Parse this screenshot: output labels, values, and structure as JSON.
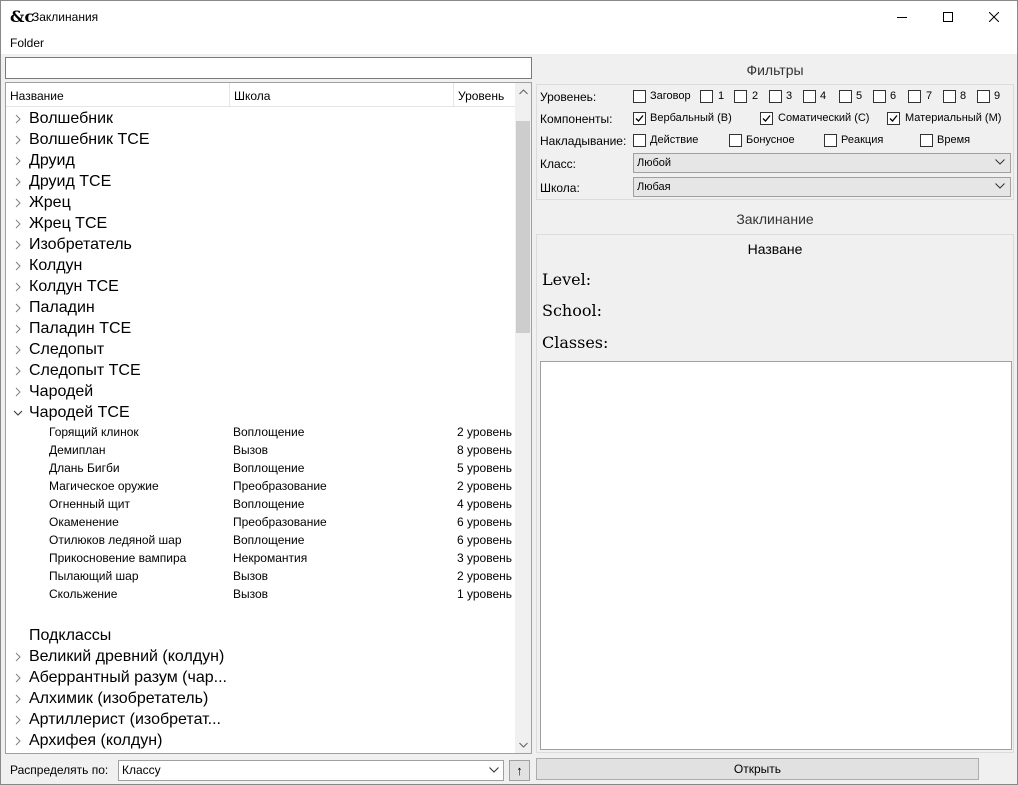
{
  "window": {
    "title": "Заклинания",
    "app_icon_glyph": "&c"
  },
  "menu": {
    "folder": "Folder"
  },
  "search": {
    "value": "",
    "placeholder": ""
  },
  "tree": {
    "columns": [
      "Название",
      "Школа",
      "Уровень"
    ],
    "groups": [
      {
        "label": "Волшебник",
        "expanded": false
      },
      {
        "label": "Волшебник  TCE",
        "expanded": false
      },
      {
        "label": "Друид",
        "expanded": false
      },
      {
        "label": "Друид  TCE",
        "expanded": false
      },
      {
        "label": "Жрец",
        "expanded": false
      },
      {
        "label": "Жрец  TCE",
        "expanded": false
      },
      {
        "label": "Изобретатель",
        "expanded": false
      },
      {
        "label": "Колдун",
        "expanded": false
      },
      {
        "label": "Колдун  TCE",
        "expanded": false
      },
      {
        "label": "Паладин",
        "expanded": false
      },
      {
        "label": "Паладин  TCE",
        "expanded": false
      },
      {
        "label": "Следопыт",
        "expanded": false
      },
      {
        "label": "Следопыт  TCE",
        "expanded": false
      },
      {
        "label": "Чародей",
        "expanded": false
      },
      {
        "label": "Чародей  TCE",
        "expanded": true
      }
    ],
    "spells": [
      {
        "name": "Горящий клинок",
        "school": "Воплощение",
        "level": "2 уровень"
      },
      {
        "name": "Демиплан",
        "school": "Вызов",
        "level": "8 уровень"
      },
      {
        "name": "Длань Бигби",
        "school": "Воплощение",
        "level": "5 уровень"
      },
      {
        "name": "Магическое оружие",
        "school": "Преобразование",
        "level": "2 уровень"
      },
      {
        "name": "Огненный щит",
        "school": "Воплощение",
        "level": "4 уровень"
      },
      {
        "name": "Окаменение",
        "school": "Преобразование",
        "level": "6 уровень"
      },
      {
        "name": "Отилюков ледяной шар",
        "school": "Воплощение",
        "level": "6 уровень"
      },
      {
        "name": "Прикосновение вампира",
        "school": "Некромантия",
        "level": "3 уровень"
      },
      {
        "name": "Пылающий шар",
        "school": "Вызов",
        "level": "2 уровень"
      },
      {
        "name": "Скольжение",
        "school": "Вызов",
        "level": "1 уровень"
      }
    ],
    "subclasses_header": "Подклассы",
    "subclasses": [
      "Великий древний (колдун)",
      "Аберрантный разум (чар...",
      "Алхимик (изобретатель)",
      "Артиллерист (изобретат...",
      "Архифея (колдун)"
    ]
  },
  "sort": {
    "label": "Распределять по:",
    "value": "Классу",
    "direction_glyph": "↑"
  },
  "filters": {
    "title": "Фильтры",
    "level_label": "Уровенеь:",
    "levels": [
      {
        "label": "Заговор",
        "checked": false
      },
      {
        "label": "1",
        "checked": false
      },
      {
        "label": "2",
        "checked": false
      },
      {
        "label": "3",
        "checked": false
      },
      {
        "label": "4",
        "checked": false
      },
      {
        "label": "5",
        "checked": false
      },
      {
        "label": "6",
        "checked": false
      },
      {
        "label": "7",
        "checked": false
      },
      {
        "label": "8",
        "checked": false
      },
      {
        "label": "9",
        "checked": false
      }
    ],
    "components_label": "Компоненты:",
    "components": [
      {
        "label": "Вербальный (В)",
        "checked": true
      },
      {
        "label": "Соматический (С)",
        "checked": true
      },
      {
        "label": "Материальный (М)",
        "checked": true
      }
    ],
    "casting_label": "Накладывание:",
    "casting": [
      {
        "label": "Действие",
        "checked": false
      },
      {
        "label": "Бонусное",
        "checked": false
      },
      {
        "label": "Реакция",
        "checked": false
      },
      {
        "label": "Время",
        "checked": false
      }
    ],
    "class_label": "Класс:",
    "class_value": "Любой",
    "school_label": "Школа:",
    "school_value": "Любая"
  },
  "spell": {
    "title": "Заклинание",
    "name": "Назване",
    "level_label": "Level:",
    "school_label": "School:",
    "classes_label": "Classes:",
    "description": ""
  },
  "open_button": "Открыть",
  "colors": {
    "window_bg": "#f0f0f0",
    "panel_border": "#dcdcdc",
    "scroll_thumb": "#cdcdcd"
  }
}
